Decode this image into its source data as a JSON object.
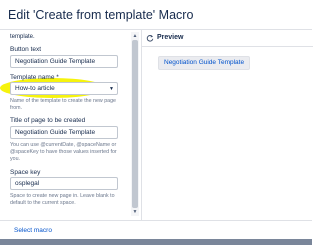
{
  "dialog": {
    "title": "Edit 'Create from template' Macro"
  },
  "params": {
    "scrolled_text": "template.",
    "button_text": {
      "label": "Button text",
      "value": "Negotiation Guide Template"
    },
    "template_name": {
      "label": "Template name *",
      "value": "How-to article",
      "help": "Name of the template to create the new page from."
    },
    "page_title": {
      "label": "Title of page to be created",
      "value": "Negotiation Guide Template",
      "help": "You can use @currentDate, @spaceName or @spaceKey to have those values inserted for you."
    },
    "space_key": {
      "label": "Space key",
      "value": "osplegal",
      "help": "Space to create new page in. Leave blank to default to the current space."
    }
  },
  "preview": {
    "label": "Preview",
    "button_label": "Negotiation Guide Template"
  },
  "footer": {
    "select_macro": "Select macro"
  },
  "colors": {
    "highlight": "#f6f200",
    "link": "#0052cc"
  },
  "icons": {
    "refresh": "refresh-icon",
    "dropdown": "chevron-down-icon"
  }
}
